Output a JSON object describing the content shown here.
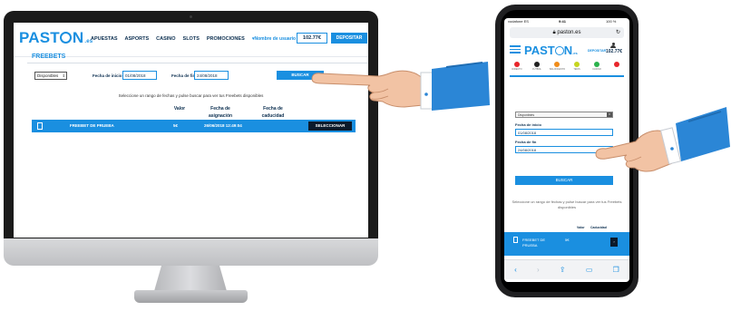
{
  "desktop": {
    "logo": {
      "name": "PAST",
      "name_end": "N",
      "tld": ".es"
    },
    "nav": [
      "APUESTAS",
      "ASPORTS",
      "CASINO",
      "SLOTS",
      "PROMOCIONES"
    ],
    "user_name": "Nombre de usuario",
    "balance": "102.77€",
    "deposit_label": "DEPOSITAR",
    "page_title": "FREEBETS",
    "filter": {
      "status_value": "Disponibles",
      "start_label": "Fecha de inicio",
      "start_value": "01/08/2018",
      "end_label": "Fecha de fin",
      "end_value": "24/08/2018",
      "search_label": "BUSCAR"
    },
    "hint": "Seleccione un rango de fechas y pulse buscar para ver tus Freebets disponibles",
    "table": {
      "headers": [
        "Valor",
        "Fecha de asignación",
        "Fecha de caducidad"
      ],
      "rows": [
        {
          "name": "FREEBET DE PRUEBA",
          "value": "5€",
          "assigned": "26/06/2018 12:49:04",
          "action": "SELECCIONAR"
        }
      ]
    }
  },
  "mobile": {
    "status": {
      "carrier": "vodafone ES",
      "time": "9:41",
      "battery": "100 %"
    },
    "url": "paston.es",
    "logo": {
      "name": "PAST",
      "name_end": "N",
      "tld": ".es"
    },
    "deposit_label": "DEPOSITAR",
    "balance": "102.77€",
    "sports": [
      {
        "label": "DIRECTO",
        "color": "#e8262b"
      },
      {
        "label": "FÚTBOL",
        "color": "#222222"
      },
      {
        "label": "BALONCESTO",
        "color": "#f08c1a"
      },
      {
        "label": "TENIS",
        "color": "#c6d51f"
      },
      {
        "label": "CASINO",
        "color": "#2bb24c"
      },
      {
        "label": "",
        "color": "#e8262b"
      }
    ],
    "filter": {
      "status_value": "Disponibles",
      "start_label": "Fecha de inicio",
      "start_value": "01/08/2018",
      "end_label": "Fecha de fin",
      "end_value": "24/08/2018",
      "search_label": "BUSCAR"
    },
    "hint": "Seleccione un rango de fechas y pulse buscar para ver tus Freebets disponibles",
    "table": {
      "headers": [
        "Valor",
        "Caducidad"
      ],
      "row": {
        "name": "FREEBET DE PRUEBA",
        "value": "5€",
        "action": "›"
      }
    },
    "safari_icons": [
      "back-icon",
      "forward-icon",
      "share-icon",
      "bookmarks-icon",
      "tabs-icon"
    ]
  },
  "colors": {
    "brand_blue": "#1a8fe0",
    "navy": "#0b2e4f",
    "dark_button": "#0b1a2b",
    "cuff_blue": "#2b86d6"
  }
}
